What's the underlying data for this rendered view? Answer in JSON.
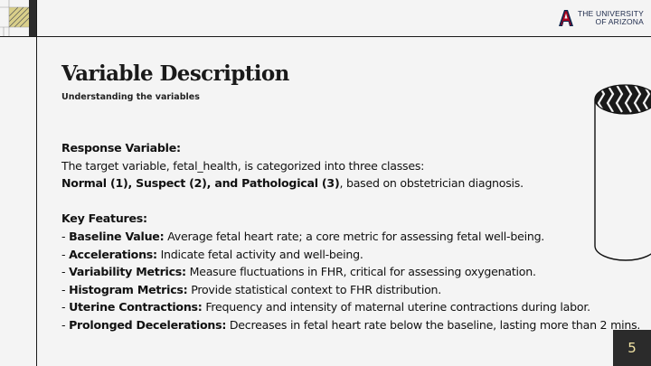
{
  "slide": {
    "title": "Variable Description",
    "subtitle": "Understanding the variables",
    "page_number": "5"
  },
  "logo": {
    "line1": "THE UNIVERSITY",
    "line2": "OF ARIZONA",
    "brand_colors": {
      "red": "#ab0520",
      "blue": "#0c234b"
    }
  },
  "response": {
    "heading": "Response Variable:",
    "line1": "The target variable, fetal_health, is categorized into three classes:",
    "classes_bold": "Normal (1), Suspect (2), and Pathological (3)",
    "classes_rest": ", based on obstetrician diagnosis."
  },
  "features": {
    "heading": "Key Features:",
    "items": [
      {
        "bullet": " - ",
        "name": "Baseline Value:",
        "desc": " Average fetal heart rate; a core metric for assessing fetal well-being."
      },
      {
        "bullet": " - ",
        "name": "Accelerations:",
        "desc": " Indicate fetal activity and well-being."
      },
      {
        "bullet": " - ",
        "name": "Variability Metrics:",
        "desc": " Measure fluctuations in FHR, critical for assessing oxygenation."
      },
      {
        "bullet": " - ",
        "name": "Histogram Metrics:",
        "desc": " Provide statistical context to FHR distribution."
      },
      {
        "bullet": " - ",
        "name": "Uterine Contractions:",
        "desc": " Frequency and intensity of maternal uterine contractions during labor."
      },
      {
        "bullet": " - ",
        "name": "Prolonged Decelerations:",
        "desc": "  Decreases in fetal heart rate below the baseline, lasting more than 2 mins."
      }
    ]
  },
  "colors": {
    "page_number_bg": "#2b2b2b",
    "page_number_text": "#f1e3a4",
    "background": "#f4f4f4"
  }
}
